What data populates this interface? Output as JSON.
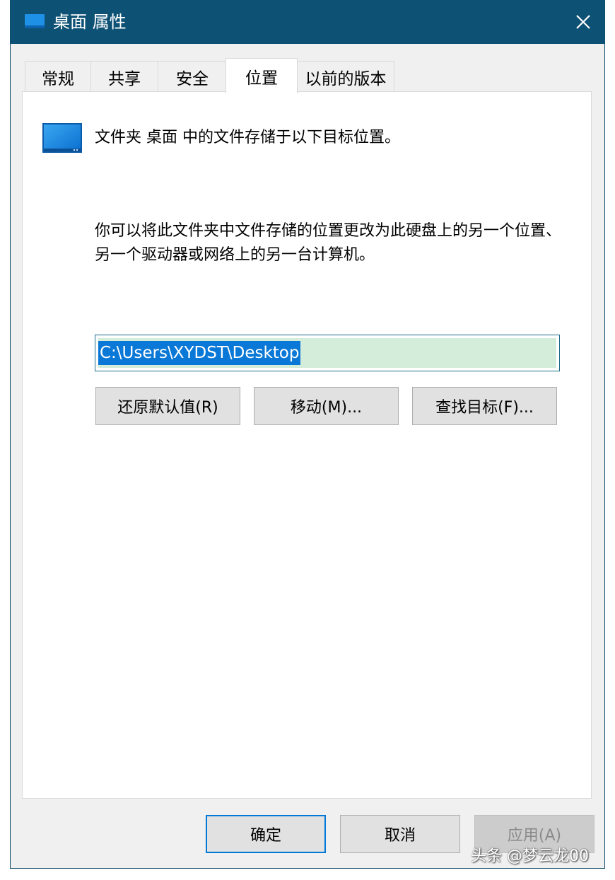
{
  "window": {
    "title": "桌面 属性",
    "close_glyph": "✕",
    "titlebar_color": "#0d5174"
  },
  "tabs": [
    {
      "label": "常规",
      "active": false
    },
    {
      "label": "共享",
      "active": false
    },
    {
      "label": "安全",
      "active": false
    },
    {
      "label": "位置",
      "active": true
    },
    {
      "label": "以前的版本",
      "active": false
    }
  ],
  "location": {
    "icon": "desktop-folder-icon",
    "intro": "文件夹 桌面 中的文件存储于以下目标位置。",
    "description": "你可以将此文件夹中文件存储的位置更改为此硬盘上的另一个位置、另一个驱动器或网络上的另一台计算机。",
    "path_value": "C:\\Users\\XYDST\\Desktop",
    "buttons": {
      "restore": "还原默认值(R)",
      "move": "移动(M)...",
      "find_target": "查找目标(F)..."
    }
  },
  "footer": {
    "ok": "确定",
    "cancel": "取消",
    "apply": "应用(A)",
    "apply_disabled": true
  },
  "watermark": {
    "text": "头条 @梦云龙00"
  },
  "colors": {
    "accent": "#0078d7",
    "selection": "#0a78d7",
    "field_fill": "#d4ecda"
  }
}
